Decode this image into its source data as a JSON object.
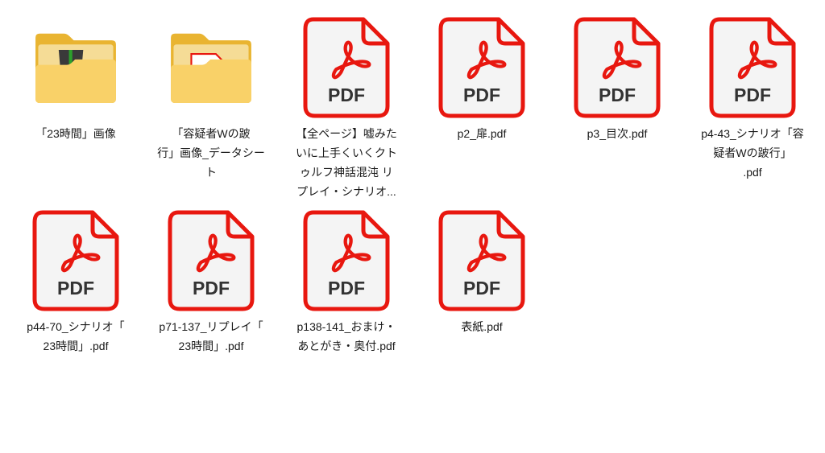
{
  "colors": {
    "pdf_red": "#e8170f",
    "folder": "#f7c948",
    "text": "#1a1a1a"
  },
  "items": [
    {
      "type": "folder",
      "preview": "image",
      "label_lines": [
        "「23時間」画像"
      ]
    },
    {
      "type": "folder",
      "preview": "pdf",
      "label_lines": [
        "「容疑者Wの跛",
        "行」画像_データシー",
        "ト"
      ]
    },
    {
      "type": "pdf",
      "badge": "PDF",
      "label_lines": [
        "【全ページ】嘘みた",
        "いに上手くいくクト",
        "ゥルフ神話混沌 リ",
        "プレイ・シナリオ..."
      ]
    },
    {
      "type": "pdf",
      "badge": "PDF",
      "label_lines": [
        "p2_扉.pdf"
      ]
    },
    {
      "type": "pdf",
      "badge": "PDF",
      "label_lines": [
        "p3_目次.pdf"
      ]
    },
    {
      "type": "pdf",
      "badge": "PDF",
      "label_lines": [
        "p4-43_シナリオ「容",
        "疑者Wの跛行」",
        ".pdf"
      ]
    },
    {
      "type": "pdf",
      "badge": "PDF",
      "label_lines": [
        "p44-70_シナリオ「",
        "23時間」.pdf"
      ]
    },
    {
      "type": "pdf",
      "badge": "PDF",
      "label_lines": [
        "p71-137_リプレイ「",
        "23時間」.pdf"
      ]
    },
    {
      "type": "pdf",
      "badge": "PDF",
      "label_lines": [
        "p138-141_おまけ・",
        "あとがき・奥付.pdf"
      ]
    },
    {
      "type": "pdf",
      "badge": "PDF",
      "label_lines": [
        "表紙.pdf"
      ]
    }
  ]
}
